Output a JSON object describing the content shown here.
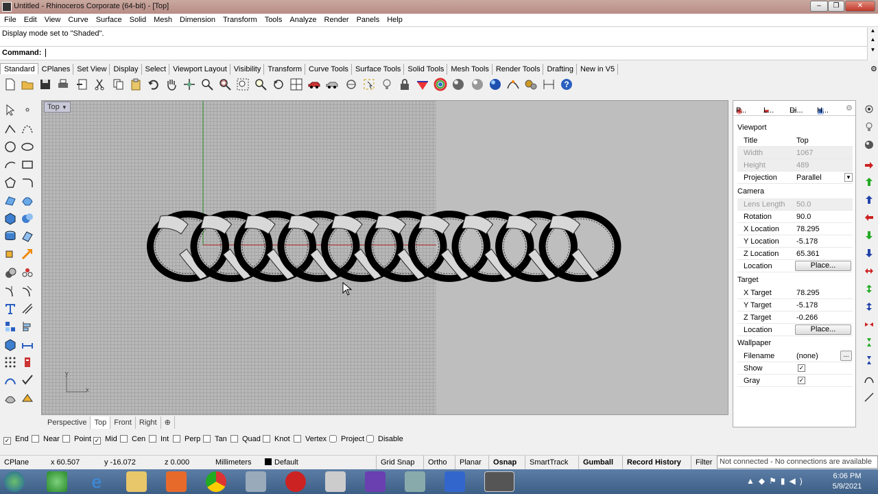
{
  "window": {
    "title": "Untitled - Rhinoceros Corporate (64-bit) - [Top]"
  },
  "menu": [
    "File",
    "Edit",
    "View",
    "Curve",
    "Surface",
    "Solid",
    "Mesh",
    "Dimension",
    "Transform",
    "Tools",
    "Analyze",
    "Render",
    "Panels",
    "Help"
  ],
  "command": {
    "history": "Display mode set to \"Shaded\".",
    "prompt": "Command:"
  },
  "tabs": [
    "Standard",
    "CPlanes",
    "Set View",
    "Display",
    "Select",
    "Viewport Layout",
    "Visibility",
    "Transform",
    "Curve Tools",
    "Surface Tools",
    "Solid Tools",
    "Mesh Tools",
    "Render Tools",
    "Drafting",
    "New in V5"
  ],
  "viewport": {
    "title": "Top",
    "tabs": [
      "Perspective",
      "Top",
      "Front",
      "Right"
    ],
    "active": "Top",
    "axis_y": "y",
    "axis_x": "x"
  },
  "osnap": [
    {
      "label": "End",
      "checked": true
    },
    {
      "label": "Near",
      "checked": false
    },
    {
      "label": "Point",
      "checked": false
    },
    {
      "label": "Mid",
      "checked": true
    },
    {
      "label": "Cen",
      "checked": false
    },
    {
      "label": "Int",
      "checked": false
    },
    {
      "label": "Perp",
      "checked": false
    },
    {
      "label": "Tan",
      "checked": false
    },
    {
      "label": "Quad",
      "checked": false
    },
    {
      "label": "Knot",
      "checked": false
    },
    {
      "label": "Vertex",
      "checked": false
    },
    {
      "label": "Project",
      "checked": false
    },
    {
      "label": "Disable",
      "checked": false
    }
  ],
  "status": {
    "cplane": "CPlane",
    "x": "x 60.507",
    "y": "y -16.072",
    "z": "z 0.000",
    "units": "Millimeters",
    "layer": "Default",
    "buttons": [
      "Grid Snap",
      "Ortho",
      "Planar",
      "Osnap",
      "SmartTrack",
      "Gumball",
      "Record History",
      "Filter"
    ],
    "bold_buttons": [
      "Osnap",
      "Gumball",
      "Record History"
    ],
    "connection": "Not connected - No connections are available"
  },
  "panel": {
    "tabs": [
      "P...",
      "L...",
      "Di...",
      "H..."
    ],
    "viewport_section": "Viewport",
    "title_label": "Title",
    "title_value": "Top",
    "width_label": "Width",
    "width_value": "1067",
    "height_label": "Height",
    "height_value": "489",
    "projection_label": "Projection",
    "projection_value": "Parallel",
    "camera_section": "Camera",
    "lens_label": "Lens Length",
    "lens_value": "50.0",
    "rotation_label": "Rotation",
    "rotation_value": "90.0",
    "xloc_label": "X Location",
    "xloc_value": "78.295",
    "yloc_label": "Y Location",
    "yloc_value": "-5.178",
    "zloc_label": "Z Location",
    "zloc_value": "65.361",
    "loc_label": "Location",
    "place_label": "Place...",
    "target_section": "Target",
    "xt_label": "X Target",
    "xt_value": "78.295",
    "yt_label": "Y Target",
    "yt_value": "-5.178",
    "zt_label": "Z Target",
    "zt_value": "-0.266",
    "tloc_label": "Location",
    "wallpaper_section": "Wallpaper",
    "filename_label": "Filename",
    "filename_value": "(none)",
    "browse_label": "...",
    "show_label": "Show",
    "gray_label": "Gray"
  },
  "clock": {
    "time": "6:06 PM",
    "date": "5/9/2021"
  }
}
